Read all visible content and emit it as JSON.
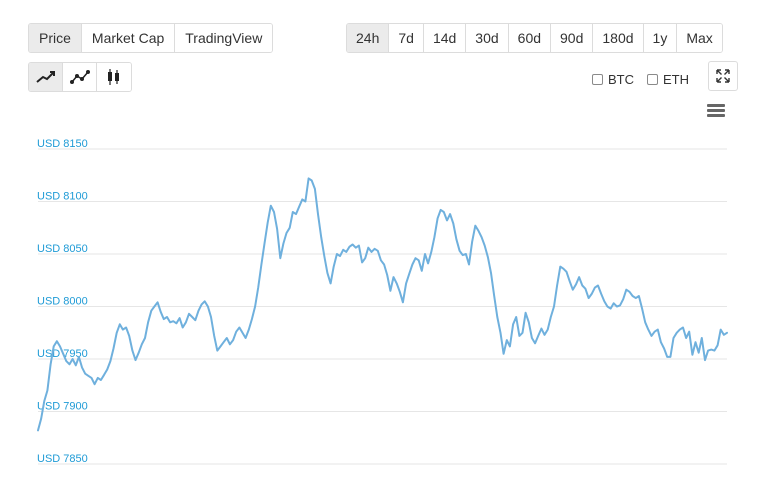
{
  "view_tabs": [
    {
      "label": "Price",
      "active": true
    },
    {
      "label": "Market Cap",
      "active": false
    },
    {
      "label": "TradingView",
      "active": false
    }
  ],
  "range_tabs": [
    {
      "label": "24h",
      "active": true
    },
    {
      "label": "7d",
      "active": false
    },
    {
      "label": "14d",
      "active": false
    },
    {
      "label": "30d",
      "active": false
    },
    {
      "label": "60d",
      "active": false
    },
    {
      "label": "90d",
      "active": false
    },
    {
      "label": "180d",
      "active": false
    },
    {
      "label": "1y",
      "active": false
    },
    {
      "label": "Max",
      "active": false
    }
  ],
  "chart_type_icons": [
    "line-chart-icon",
    "marker-line-chart-icon",
    "candlestick-chart-icon"
  ],
  "compare": {
    "btc_label": "BTC",
    "eth_label": "ETH",
    "btc_checked": false,
    "eth_checked": false
  },
  "colors": {
    "line": "#6fb0dd",
    "axis_label": "#1f9bd6",
    "grid": "#e6e6e6"
  },
  "chart_data": {
    "type": "line",
    "ylim": [
      7830,
      8160
    ],
    "yticks": [
      7850,
      7900,
      7950,
      8000,
      8050,
      8100,
      8150
    ],
    "ytick_labels": [
      "USD 7850",
      "USD 7900",
      "USD 7950",
      "USD 8000",
      "USD 8050",
      "USD 8100",
      "USD 8150"
    ],
    "grid": true,
    "series": [
      {
        "values": [
          7882,
          7893,
          7910,
          7920,
          7945,
          7962,
          7967,
          7962,
          7955,
          7948,
          7945,
          7950,
          7944,
          7952,
          7942,
          7936,
          7934,
          7932,
          7926,
          7932,
          7930,
          7935,
          7940,
          7948,
          7960,
          7975,
          7983,
          7978,
          7980,
          7972,
          7958,
          7949,
          7956,
          7964,
          7970,
          7985,
          7996,
          8000,
          8004,
          7995,
          7988,
          7990,
          7985,
          7986,
          7984,
          7989,
          7980,
          7985,
          7993,
          7990,
          7987,
          7996,
          8002,
          8005,
          8000,
          7990,
          7972,
          7958,
          7962,
          7966,
          7970,
          7964,
          7968,
          7976,
          7980,
          7975,
          7970,
          7978,
          7988,
          8000,
          8018,
          8040,
          8060,
          8080,
          8096,
          8090,
          8074,
          8046,
          8060,
          8070,
          8075,
          8090,
          8088,
          8095,
          8102,
          8100,
          8122,
          8120,
          8112,
          8088,
          8066,
          8048,
          8032,
          8022,
          8038,
          8050,
          8048,
          8054,
          8052,
          8057,
          8059,
          8056,
          8058,
          8042,
          8046,
          8056,
          8052,
          8055,
          8053,
          8044,
          8040,
          8030,
          8015,
          8028,
          8022,
          8014,
          8004,
          8022,
          8031,
          8040,
          8046,
          8044,
          8034,
          8050,
          8041,
          8052,
          8066,
          8084,
          8092,
          8090,
          8082,
          8088,
          8079,
          8064,
          8053,
          8049,
          8050,
          8040,
          8062,
          8077,
          8072,
          8066,
          8058,
          8047,
          8032,
          8010,
          7990,
          7975,
          7955,
          7968,
          7962,
          7983,
          7990,
          7972,
          7975,
          7994,
          7985,
          7970,
          7965,
          7972,
          7979,
          7973,
          7978,
          7990,
          8000,
          8020,
          8038,
          8036,
          8033,
          8024,
          8016,
          8021,
          8028,
          8020,
          8017,
          8008,
          8012,
          8018,
          8020,
          8012,
          8005,
          8000,
          7998,
          8003,
          8000,
          8001,
          8007,
          8016,
          8014,
          8010,
          8008,
          8010,
          7998,
          7985,
          7978,
          7972,
          7976,
          7978,
          7966,
          7960,
          7952,
          7952,
          7970,
          7975,
          7978,
          7980,
          7970,
          7976,
          7954,
          7966,
          7956,
          7970,
          7949,
          7958,
          7959,
          7958,
          7963,
          7978,
          7973,
          7975
        ]
      }
    ]
  }
}
